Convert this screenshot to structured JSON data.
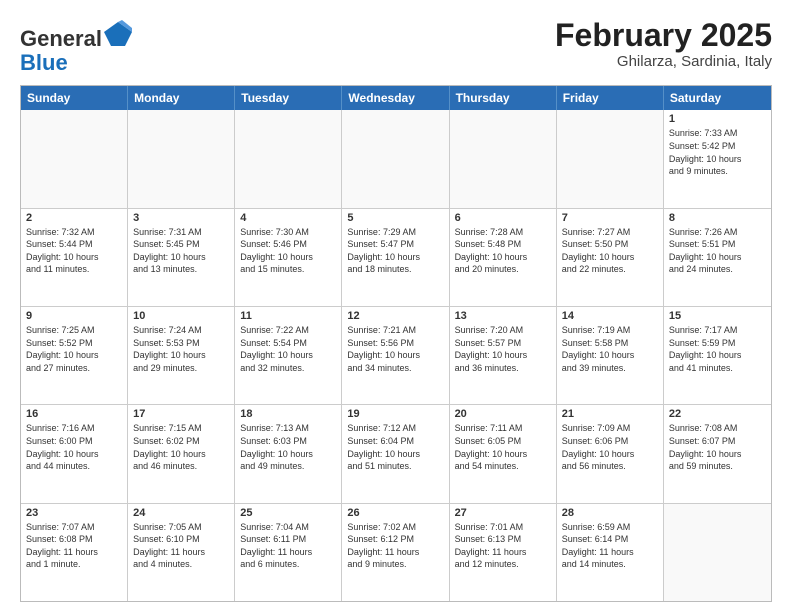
{
  "logo": {
    "line1": "General",
    "line2": "Blue"
  },
  "title": "February 2025",
  "subtitle": "Ghilarza, Sardinia, Italy",
  "header": {
    "days": [
      "Sunday",
      "Monday",
      "Tuesday",
      "Wednesday",
      "Thursday",
      "Friday",
      "Saturday"
    ]
  },
  "weeks": [
    {
      "cells": [
        {
          "day": "",
          "empty": true
        },
        {
          "day": "",
          "empty": true
        },
        {
          "day": "",
          "empty": true
        },
        {
          "day": "",
          "empty": true
        },
        {
          "day": "",
          "empty": true
        },
        {
          "day": "",
          "empty": true
        },
        {
          "day": "1",
          "info": "Sunrise: 7:33 AM\nSunset: 5:42 PM\nDaylight: 10 hours\nand 9 minutes."
        }
      ]
    },
    {
      "cells": [
        {
          "day": "2",
          "info": "Sunrise: 7:32 AM\nSunset: 5:44 PM\nDaylight: 10 hours\nand 11 minutes."
        },
        {
          "day": "3",
          "info": "Sunrise: 7:31 AM\nSunset: 5:45 PM\nDaylight: 10 hours\nand 13 minutes."
        },
        {
          "day": "4",
          "info": "Sunrise: 7:30 AM\nSunset: 5:46 PM\nDaylight: 10 hours\nand 15 minutes."
        },
        {
          "day": "5",
          "info": "Sunrise: 7:29 AM\nSunset: 5:47 PM\nDaylight: 10 hours\nand 18 minutes."
        },
        {
          "day": "6",
          "info": "Sunrise: 7:28 AM\nSunset: 5:48 PM\nDaylight: 10 hours\nand 20 minutes."
        },
        {
          "day": "7",
          "info": "Sunrise: 7:27 AM\nSunset: 5:50 PM\nDaylight: 10 hours\nand 22 minutes."
        },
        {
          "day": "8",
          "info": "Sunrise: 7:26 AM\nSunset: 5:51 PM\nDaylight: 10 hours\nand 24 minutes."
        }
      ]
    },
    {
      "cells": [
        {
          "day": "9",
          "info": "Sunrise: 7:25 AM\nSunset: 5:52 PM\nDaylight: 10 hours\nand 27 minutes."
        },
        {
          "day": "10",
          "info": "Sunrise: 7:24 AM\nSunset: 5:53 PM\nDaylight: 10 hours\nand 29 minutes."
        },
        {
          "day": "11",
          "info": "Sunrise: 7:22 AM\nSunset: 5:54 PM\nDaylight: 10 hours\nand 32 minutes."
        },
        {
          "day": "12",
          "info": "Sunrise: 7:21 AM\nSunset: 5:56 PM\nDaylight: 10 hours\nand 34 minutes."
        },
        {
          "day": "13",
          "info": "Sunrise: 7:20 AM\nSunset: 5:57 PM\nDaylight: 10 hours\nand 36 minutes."
        },
        {
          "day": "14",
          "info": "Sunrise: 7:19 AM\nSunset: 5:58 PM\nDaylight: 10 hours\nand 39 minutes."
        },
        {
          "day": "15",
          "info": "Sunrise: 7:17 AM\nSunset: 5:59 PM\nDaylight: 10 hours\nand 41 minutes."
        }
      ]
    },
    {
      "cells": [
        {
          "day": "16",
          "info": "Sunrise: 7:16 AM\nSunset: 6:00 PM\nDaylight: 10 hours\nand 44 minutes."
        },
        {
          "day": "17",
          "info": "Sunrise: 7:15 AM\nSunset: 6:02 PM\nDaylight: 10 hours\nand 46 minutes."
        },
        {
          "day": "18",
          "info": "Sunrise: 7:13 AM\nSunset: 6:03 PM\nDaylight: 10 hours\nand 49 minutes."
        },
        {
          "day": "19",
          "info": "Sunrise: 7:12 AM\nSunset: 6:04 PM\nDaylight: 10 hours\nand 51 minutes."
        },
        {
          "day": "20",
          "info": "Sunrise: 7:11 AM\nSunset: 6:05 PM\nDaylight: 10 hours\nand 54 minutes."
        },
        {
          "day": "21",
          "info": "Sunrise: 7:09 AM\nSunset: 6:06 PM\nDaylight: 10 hours\nand 56 minutes."
        },
        {
          "day": "22",
          "info": "Sunrise: 7:08 AM\nSunset: 6:07 PM\nDaylight: 10 hours\nand 59 minutes."
        }
      ]
    },
    {
      "cells": [
        {
          "day": "23",
          "info": "Sunrise: 7:07 AM\nSunset: 6:08 PM\nDaylight: 11 hours\nand 1 minute."
        },
        {
          "day": "24",
          "info": "Sunrise: 7:05 AM\nSunset: 6:10 PM\nDaylight: 11 hours\nand 4 minutes."
        },
        {
          "day": "25",
          "info": "Sunrise: 7:04 AM\nSunset: 6:11 PM\nDaylight: 11 hours\nand 6 minutes."
        },
        {
          "day": "26",
          "info": "Sunrise: 7:02 AM\nSunset: 6:12 PM\nDaylight: 11 hours\nand 9 minutes."
        },
        {
          "day": "27",
          "info": "Sunrise: 7:01 AM\nSunset: 6:13 PM\nDaylight: 11 hours\nand 12 minutes."
        },
        {
          "day": "28",
          "info": "Sunrise: 6:59 AM\nSunset: 6:14 PM\nDaylight: 11 hours\nand 14 minutes."
        },
        {
          "day": "",
          "empty": true
        }
      ]
    }
  ]
}
